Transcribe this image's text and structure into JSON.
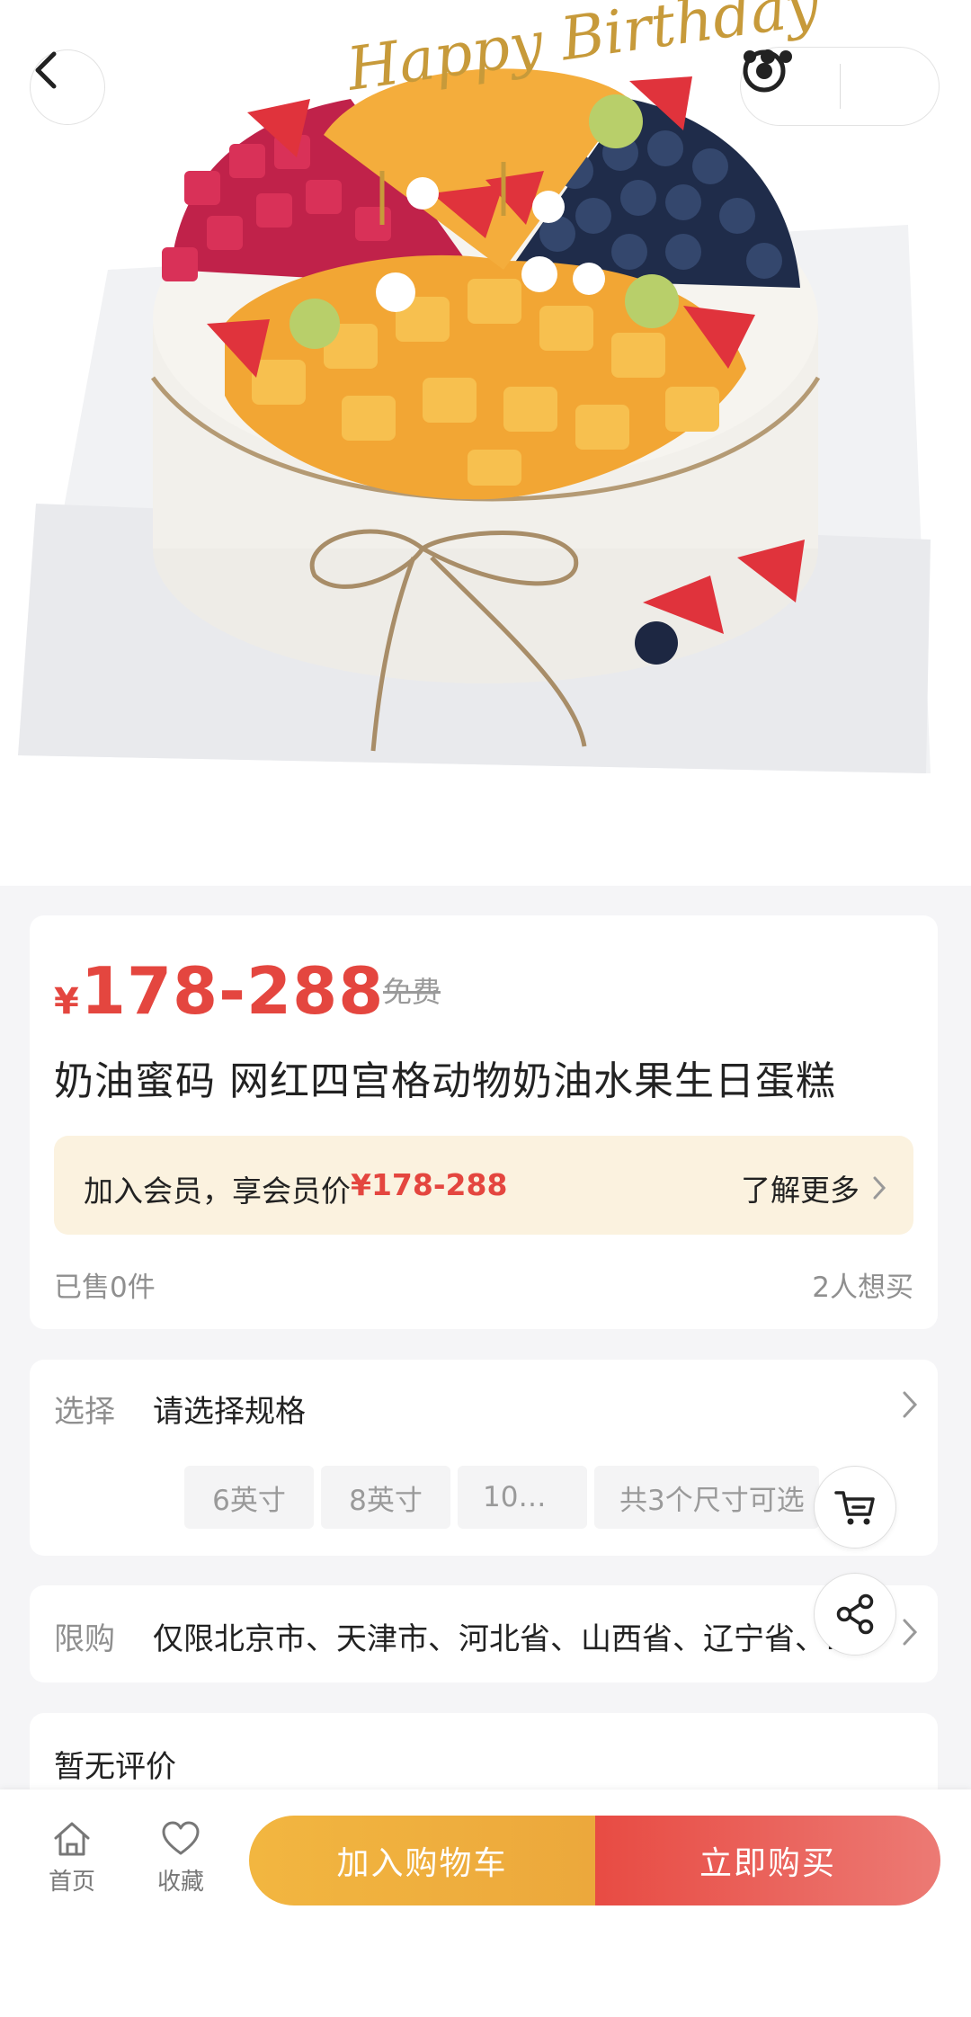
{
  "hero": {
    "cake_topper_text": "Happy Birthday"
  },
  "price": {
    "currency": "¥",
    "range": "178-288",
    "tag": "免费"
  },
  "product": {
    "title": "奶油蜜码 网红四宫格动物奶油水果生日蛋糕"
  },
  "member": {
    "text": "加入会员，享会员价",
    "price": "¥178-288",
    "more": "了解更多"
  },
  "stats": {
    "sold": "已售0件",
    "want": "2人想买"
  },
  "spec": {
    "label": "选择",
    "value": "请选择规格",
    "chips": [
      "6英寸",
      "8英寸",
      "10…",
      "共3个尺寸可选"
    ]
  },
  "limit": {
    "label": "限购",
    "value": "仅限北京市、天津市、河北省、山西省、辽宁省、吉林省、黑龙江省"
  },
  "review": {
    "title": "暂无评价"
  },
  "bottom": {
    "home": "首页",
    "favorite": "收藏",
    "add_to_cart": "加入购物车",
    "buy_now": "立即购买"
  },
  "colors": {
    "price": "#e4463f",
    "member_bg": "#fbf2df",
    "cart_button": "#efb03e",
    "buy_button": "#e95a52"
  },
  "icons": [
    "back-icon",
    "more-icon",
    "target-icon",
    "cart-icon",
    "share-icon",
    "home-icon",
    "heart-icon",
    "chevron-right-icon"
  ]
}
